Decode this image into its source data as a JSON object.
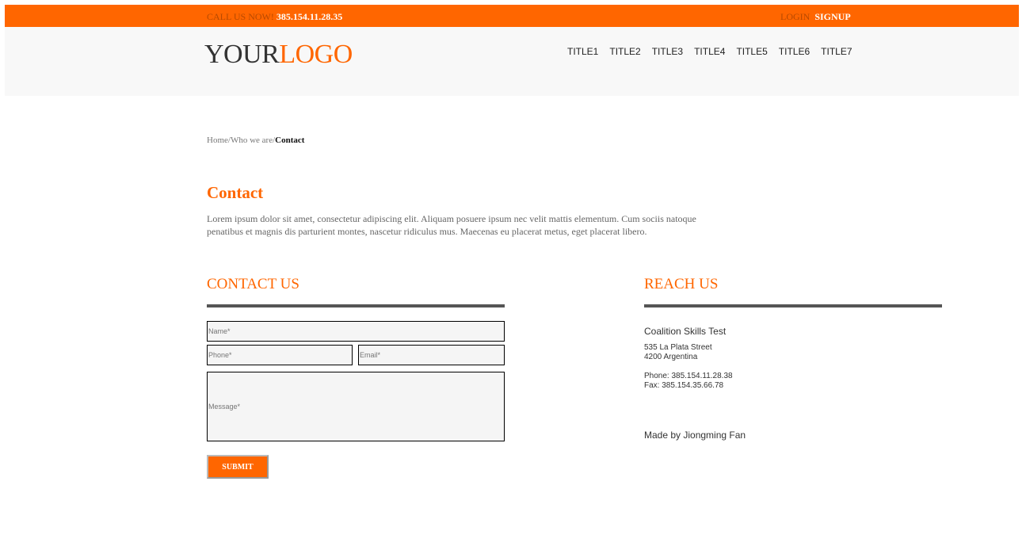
{
  "topbar": {
    "call_label": "CALL US NOW!",
    "phone": "385.154.11.28.35",
    "login": "LOGIN",
    "signup": "SIGNUP"
  },
  "header": {
    "logo_part1": "YOUR",
    "logo_part2": "LOGO",
    "nav": [
      "TITLE1",
      "TITLE2",
      "TITLE3",
      "TITLE4",
      "TITLE5",
      "TITLE6",
      "TITLE7"
    ]
  },
  "breadcrumb": {
    "home": "Home",
    "sep1": "/",
    "section": "Who we are",
    "sep2": "/",
    "current": "Contact"
  },
  "page": {
    "title": "Contact",
    "intro": "Lorem ipsum dolor sit amet, consectetur adipiscing elit. Aliquam posuere ipsum nec velit mattis elementum. Cum sociis natoque penatibus et magnis dis parturient montes, nascetur ridiculus mus. Maecenas eu placerat metus, eget placerat libero."
  },
  "contact_form": {
    "heading": "CONTACT US",
    "name_placeholder": "Name*",
    "phone_placeholder": "Phone*",
    "email_placeholder": "Email*",
    "message_placeholder": "Message*",
    "submit_label": "SUBMIT"
  },
  "reach": {
    "heading": "REACH US",
    "org": "Coalition Skills Test",
    "street": "535 La Plata Street",
    "city": "4200 Argentina",
    "phone": "Phone: 385.154.11.28.38",
    "fax": "Fax: 385.154.35.66.78",
    "credit": "Made by Jiongming Fan"
  },
  "colors": {
    "accent": "#ff6600",
    "rule": "#555555",
    "header_bg": "#f8f8f8"
  }
}
